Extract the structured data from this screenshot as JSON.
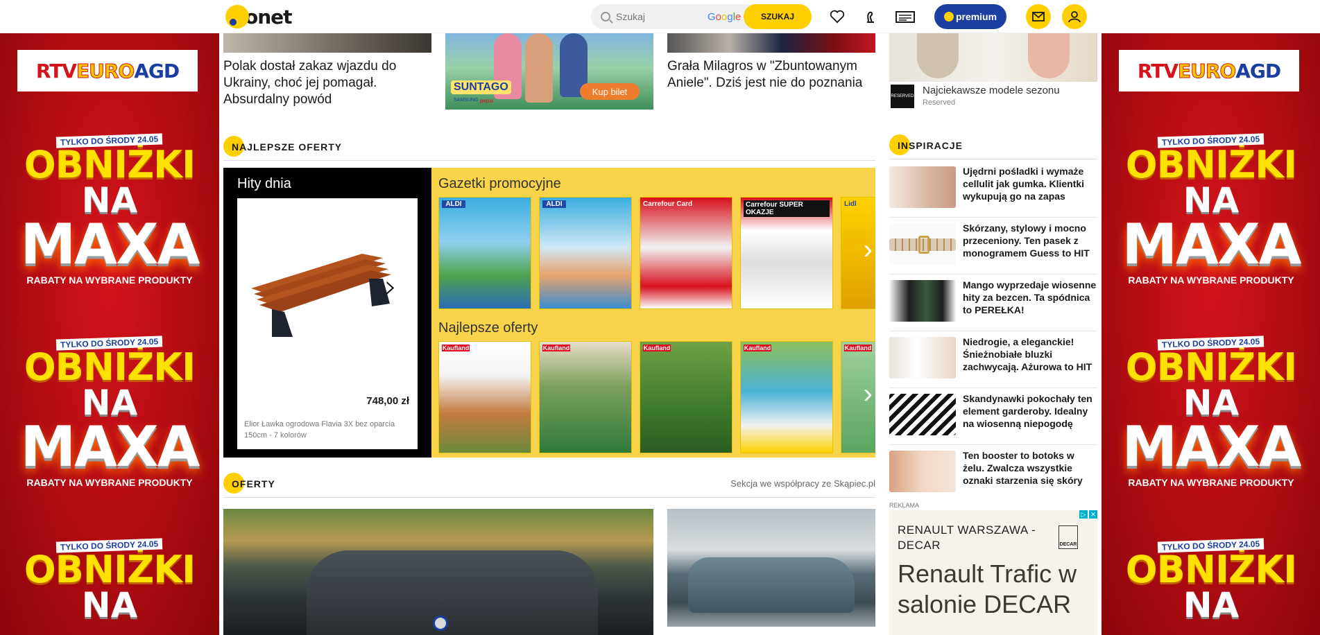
{
  "header": {
    "logo_text": "onet",
    "search_placeholder": "Szukaj",
    "google_label": "Google",
    "search_button": "SZUKAJ",
    "premium_label": "premium"
  },
  "side_ad": {
    "brand_part1": "RTV",
    "brand_part2": "EURO",
    "brand_part3": "AGD",
    "until_label": "TYLKO DO ŚRODY 24.05",
    "headline_1": "OBNIŻKI",
    "headline_2": "NA",
    "headline_3": "MAXA",
    "subline": "RABATY NA WYBRANE PRODUKTY"
  },
  "top_articles": [
    {
      "title": "Polak dostał zakaz wjazdu do Ukrainy, choć jej pomagał. Absurdalny powód"
    },
    {
      "title": "Grała Milagros w \"Zbuntowanym Aniele\". Dziś jest nie do poznania"
    }
  ],
  "suntago_ad": {
    "brand": "SUNTAGO",
    "cta": "Kup bilet",
    "sponsor1": "SAMSUNG",
    "sponsor2": "pepsi"
  },
  "fashion_ad": {
    "title": "Najciekawsze modele sezonu",
    "advertiser": "Reserved",
    "logo_text": "RESERVED"
  },
  "sections": {
    "best_offers": "NAJLEPSZE OFERTY",
    "inspirations": "INSPIRACJE",
    "offers": "OFERTY",
    "offers_note": "Sekcja we współpracy ze Skąpiec.pl"
  },
  "hity_dnia": {
    "title": "Hity dnia",
    "price": "748,00 zł",
    "description": "Elior Ławka ogrodowa Flavia 3X bez oparcia 150cm - 7 kolorów"
  },
  "gazetki": {
    "title_promo": "Gazetki promocyjne",
    "title_best": "Najlepsze oferty",
    "row1": [
      "ALDI",
      "ALDI",
      "Carrefour Card",
      "Carrefour SUPER OKAZJE",
      "Lidl"
    ],
    "row2": [
      "Kaufland",
      "Kaufland",
      "Kaufland",
      "Kaufland",
      "Kaufland"
    ]
  },
  "inspirations": [
    {
      "title": "Ujędrni pośladki i wymaże cellulit jak gumka. Klientki wykupują go na zapas"
    },
    {
      "title": "Skórzany, stylowy i mocno przeceniony. Ten pasek z monogramem Guess to HIT"
    },
    {
      "title": "Mango wyprzedaje wiosenne hity za bezcen. Ta spódnica to PEREŁKA!"
    },
    {
      "title": "Niedrogie, a eleganckie! Śnieżnobiałe bluzki zachwycają. Ażurowa to HIT"
    },
    {
      "title": "Skandynawki pokochały ten element garderoby. Idealny na wiosenną niepogodę"
    },
    {
      "title": "Ten booster to botoks w żelu. Zwalcza wszystkie oznaki starzenia się skóry"
    }
  ],
  "ad": {
    "label": "REKLAMA",
    "advertiser": "RENAULT WARSZAWA - DECAR",
    "decar_badge": "DECAR",
    "headline": "Renault Trafic w salonie DECAR"
  },
  "colors": {
    "brand_yellow": "#ffcf00",
    "premium_blue": "#1b3fa0",
    "ad_red": "#c8101a",
    "gazetki_bg": "#f9d34a"
  },
  "icons": [
    "search-icon",
    "heart-icon",
    "horoscope-icon",
    "tv-program-icon",
    "mail-icon",
    "user-icon",
    "chevron-right-icon"
  ]
}
